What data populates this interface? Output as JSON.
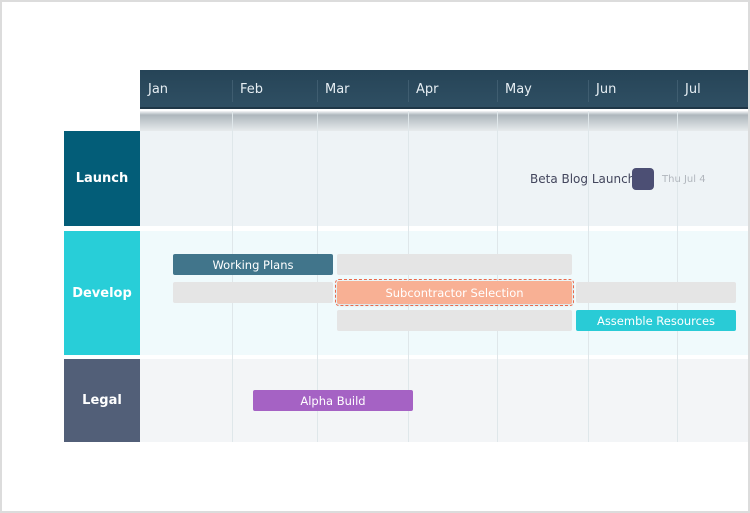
{
  "timeline": {
    "months": [
      "Jan",
      "Feb",
      "Mar",
      "Apr",
      "May",
      "Jun",
      "Jul"
    ]
  },
  "lanes": [
    {
      "label": "Launch",
      "color": "#035d78",
      "background": "#eef3f6"
    },
    {
      "label": "Develop",
      "color": "#28ced8",
      "background": "#f0fafc"
    },
    {
      "label": "Legal",
      "color": "#525f78",
      "background": "#f3f5f7"
    }
  ],
  "milestone": {
    "label": "Beta Blog Launch",
    "date": "Thu Jul 4",
    "color": "#4c4f74"
  },
  "tasks": [
    {
      "label": "Working Plans",
      "lane": "Develop",
      "color": "#41758b",
      "state": "normal"
    },
    {
      "label": "Subcontractor Selection",
      "lane": "Develop",
      "color": "#f8b094",
      "state": "selected-dragging"
    },
    {
      "label": "Assemble Resources",
      "lane": "Develop",
      "color": "#29cbd6",
      "state": "normal"
    },
    {
      "label": "Alpha Build",
      "lane": "Legal",
      "color": "#a562c4",
      "state": "normal"
    }
  ]
}
